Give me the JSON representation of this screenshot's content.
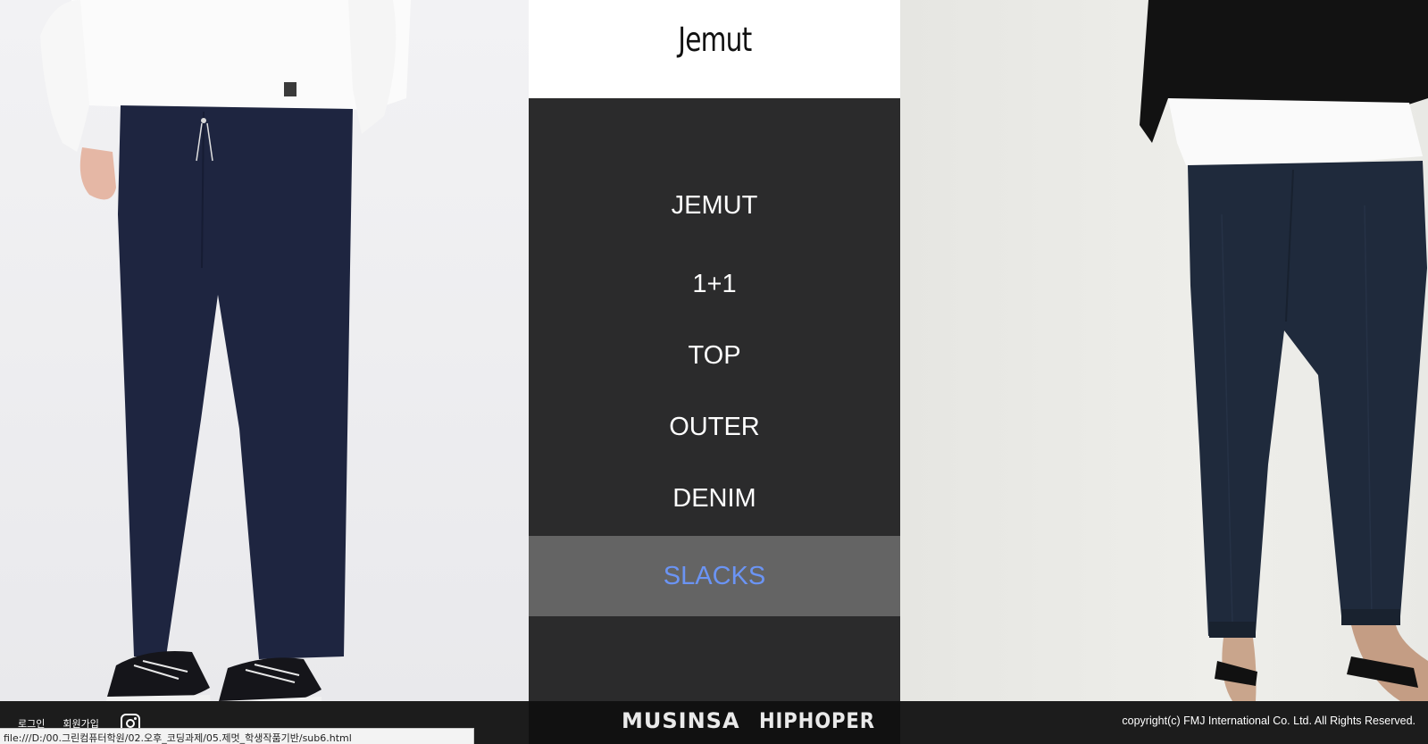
{
  "window": {
    "status_url": "file:///D:/00.그린컴퓨터학원/02.오후_코딩과제/05.제멋_학생작품기반/sub6.html"
  },
  "header": {
    "logo_text": "Jemut"
  },
  "nav": {
    "items": [
      {
        "label": "JEMUT",
        "active": false
      },
      {
        "label": "1+1",
        "active": false
      },
      {
        "label": "TOP",
        "active": false
      },
      {
        "label": "OUTER",
        "active": false
      },
      {
        "label": "DENIM",
        "active": false
      },
      {
        "label": "SLACKS",
        "active": true
      }
    ],
    "active_color": "#6b94f4"
  },
  "footer": {
    "login_label": "로그인",
    "signup_label": "회원가입",
    "instagram_icon": "instagram-icon",
    "brands": [
      "MUSINSA",
      "HIPHOPER"
    ],
    "copyright": "copyright(c) FMJ International Co. Ltd. All Rights Reserved."
  },
  "colors": {
    "nav_bg": "#2b2b2c",
    "active_bg": "#646464",
    "footer_bg": "#1c1c1c"
  }
}
